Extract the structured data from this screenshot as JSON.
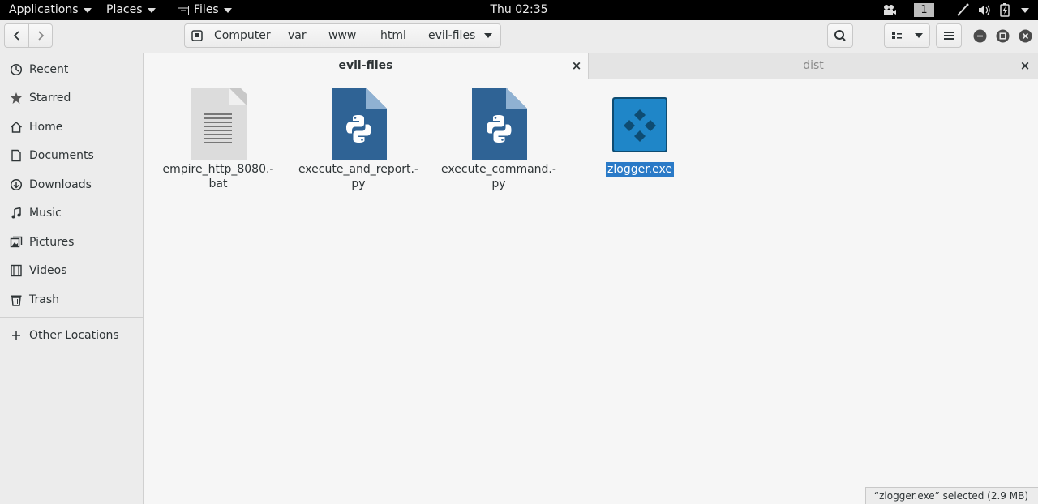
{
  "topbar": {
    "applications": "Applications",
    "places": "Places",
    "files": "Files",
    "clock": "Thu 02:35",
    "workspace": "1"
  },
  "headerbar": {
    "path": [
      "Computer",
      "var",
      "www",
      "html",
      "evil-files"
    ]
  },
  "sidebar": {
    "items": [
      {
        "label": "Recent",
        "icon": "clock-icon"
      },
      {
        "label": "Starred",
        "icon": "star-icon"
      },
      {
        "label": "Home",
        "icon": "home-icon"
      },
      {
        "label": "Documents",
        "icon": "document-icon"
      },
      {
        "label": "Downloads",
        "icon": "download-icon"
      },
      {
        "label": "Music",
        "icon": "music-icon"
      },
      {
        "label": "Pictures",
        "icon": "pictures-icon"
      },
      {
        "label": "Videos",
        "icon": "videos-icon"
      },
      {
        "label": "Trash",
        "icon": "trash-icon"
      }
    ],
    "other_locations": "Other Locations"
  },
  "tabs": [
    {
      "label": "evil-files",
      "active": true
    },
    {
      "label": "dist",
      "active": false
    }
  ],
  "files": [
    {
      "line1": "empire_http_8080.-",
      "line2": "bat",
      "icon": "text-file-icon"
    },
    {
      "line1": "execute_and_report.-",
      "line2": "py",
      "icon": "python-file-icon"
    },
    {
      "line1": "execute_command.-",
      "line2": "py",
      "icon": "python-file-icon"
    },
    {
      "line1": "zlogger.exe",
      "line2": "",
      "icon": "exe-file-icon",
      "selected": true
    }
  ],
  "status": "“zlogger.exe” selected  (2.9 MB)",
  "colors": {
    "selection": "#2a7ac7",
    "python_icon": "#2f6395",
    "exe_icon": "#1f86c8"
  }
}
